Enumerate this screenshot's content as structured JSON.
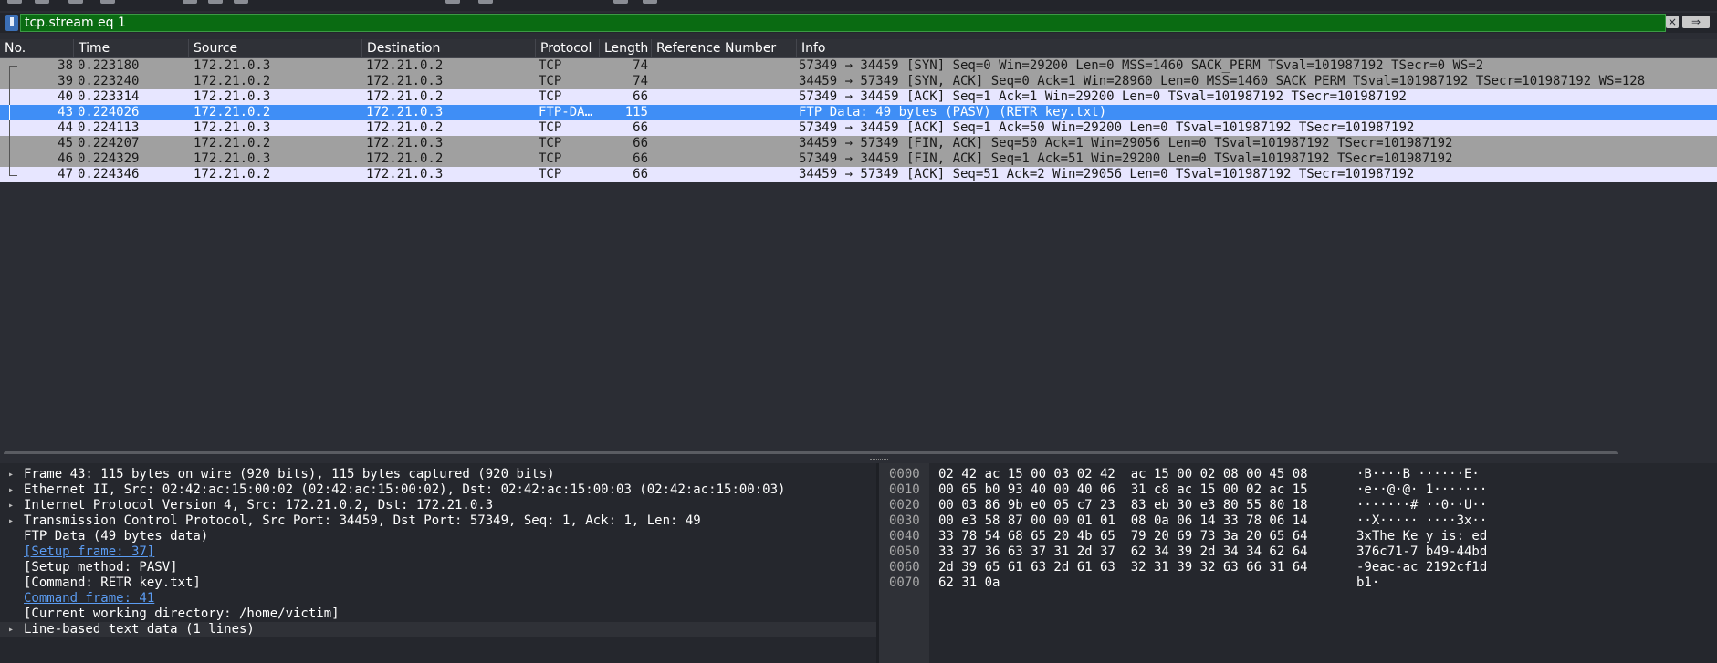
{
  "filter": {
    "value": "tcp.stream eq 1",
    "clear_icon": "×",
    "apply_icon": "⇒"
  },
  "columns": [
    "No.",
    "Time",
    "Source",
    "Destination",
    "Protocol",
    "Length",
    "Reference Number",
    "Info"
  ],
  "packets": [
    {
      "no": "38",
      "time": "0.223180",
      "src": "172.21.0.3",
      "dst": "172.21.0.2",
      "proto": "TCP",
      "len": "74",
      "ref": "",
      "info": "57349 → 34459 [SYN] Seq=0 Win=29200 Len=0 MSS=1460 SACK_PERM TSval=101987192 TSecr=0 WS=2",
      "style": "gray"
    },
    {
      "no": "39",
      "time": "0.223240",
      "src": "172.21.0.2",
      "dst": "172.21.0.3",
      "proto": "TCP",
      "len": "74",
      "ref": "",
      "info": "34459 → 57349 [SYN, ACK] Seq=0 Ack=1 Win=28960 Len=0 MSS=1460 SACK_PERM TSval=101987192 TSecr=101987192 WS=128",
      "style": "gray"
    },
    {
      "no": "40",
      "time": "0.223314",
      "src": "172.21.0.3",
      "dst": "172.21.0.2",
      "proto": "TCP",
      "len": "66",
      "ref": "",
      "info": "57349 → 34459 [ACK] Seq=1 Ack=1 Win=29200 Len=0 TSval=101987192 TSecr=101987192",
      "style": "light"
    },
    {
      "no": "43",
      "time": "0.224026",
      "src": "172.21.0.2",
      "dst": "172.21.0.3",
      "proto": "FTP-DA…",
      "len": "115",
      "ref": "",
      "info": "FTP Data: 49 bytes (PASV) (RETR key.txt)",
      "style": "selected"
    },
    {
      "no": "44",
      "time": "0.224113",
      "src": "172.21.0.3",
      "dst": "172.21.0.2",
      "proto": "TCP",
      "len": "66",
      "ref": "",
      "info": "57349 → 34459 [ACK] Seq=1 Ack=50 Win=29200 Len=0 TSval=101987192 TSecr=101987192",
      "style": "light"
    },
    {
      "no": "45",
      "time": "0.224207",
      "src": "172.21.0.2",
      "dst": "172.21.0.3",
      "proto": "TCP",
      "len": "66",
      "ref": "",
      "info": "34459 → 57349 [FIN, ACK] Seq=50 Ack=1 Win=29056 Len=0 TSval=101987192 TSecr=101987192",
      "style": "gray"
    },
    {
      "no": "46",
      "time": "0.224329",
      "src": "172.21.0.3",
      "dst": "172.21.0.2",
      "proto": "TCP",
      "len": "66",
      "ref": "",
      "info": "57349 → 34459 [FIN, ACK] Seq=1 Ack=51 Win=29200 Len=0 TSval=101987192 TSecr=101987192",
      "style": "gray"
    },
    {
      "no": "47",
      "time": "0.224346",
      "src": "172.21.0.2",
      "dst": "172.21.0.3",
      "proto": "TCP",
      "len": "66",
      "ref": "",
      "info": "34459 → 57349 [ACK] Seq=51 Ack=2 Win=29056 Len=0 TSval=101987192 TSecr=101987192",
      "style": "light"
    }
  ],
  "details": [
    {
      "text": "Frame 43: 115 bytes on wire (920 bits), 115 bytes captured (920 bits)",
      "arrow": "▸",
      "link": false
    },
    {
      "text": "Ethernet II, Src: 02:42:ac:15:00:02 (02:42:ac:15:00:02), Dst: 02:42:ac:15:00:03 (02:42:ac:15:00:03)",
      "arrow": "▸",
      "link": false
    },
    {
      "text": "Internet Protocol Version 4, Src: 172.21.0.2, Dst: 172.21.0.3",
      "arrow": "▸",
      "link": false
    },
    {
      "text": "Transmission Control Protocol, Src Port: 34459, Dst Port: 57349, Seq: 1, Ack: 1, Len: 49",
      "arrow": "▸",
      "link": false
    },
    {
      "text": "FTP Data (49 bytes data)",
      "arrow": "",
      "link": false
    },
    {
      "text": "[Setup frame: 37]",
      "arrow": "",
      "link": true
    },
    {
      "text": "[Setup method: PASV]",
      "arrow": "",
      "link": false
    },
    {
      "text": "[Command: RETR key.txt]",
      "arrow": "",
      "link": false
    },
    {
      "text": "Command frame: 41",
      "arrow": "",
      "link": true
    },
    {
      "text": "[Current working directory: /home/victim]",
      "arrow": "",
      "link": false
    },
    {
      "text": "Line-based text data (1 lines)",
      "arrow": "▸",
      "link": false
    }
  ],
  "bytes": [
    {
      "offset": "0000",
      "hex": "02 42 ac 15 00 03 02 42  ac 15 00 02 08 00 45 08",
      "ascii": "·B····B ······E·"
    },
    {
      "offset": "0010",
      "hex": "00 65 b0 93 40 00 40 06  31 c8 ac 15 00 02 ac 15",
      "ascii": "·e··@·@· 1·······"
    },
    {
      "offset": "0020",
      "hex": "00 03 86 9b e0 05 c7 23  83 eb 30 e3 80 55 80 18",
      "ascii": "·······# ··0··U··"
    },
    {
      "offset": "0030",
      "hex": "00 e3 58 87 00 00 01 01  08 0a 06 14 33 78 06 14",
      "ascii": "··X····· ····3x··"
    },
    {
      "offset": "0040",
      "hex": "33 78 54 68 65 20 4b 65  79 20 69 73 3a 20 65 64",
      "ascii": "3xThe Ke y is: ed"
    },
    {
      "offset": "0050",
      "hex": "33 37 36 63 37 31 2d 37  62 34 39 2d 34 34 62 64",
      "ascii": "376c71-7 b49-44bd"
    },
    {
      "offset": "0060",
      "hex": "2d 39 65 61 63 2d 61 63  32 31 39 32 63 66 31 64",
      "ascii": "-9eac-ac 2192cf1d"
    },
    {
      "offset": "0070",
      "hex": "62 31 0a",
      "ascii": "b1·"
    }
  ]
}
